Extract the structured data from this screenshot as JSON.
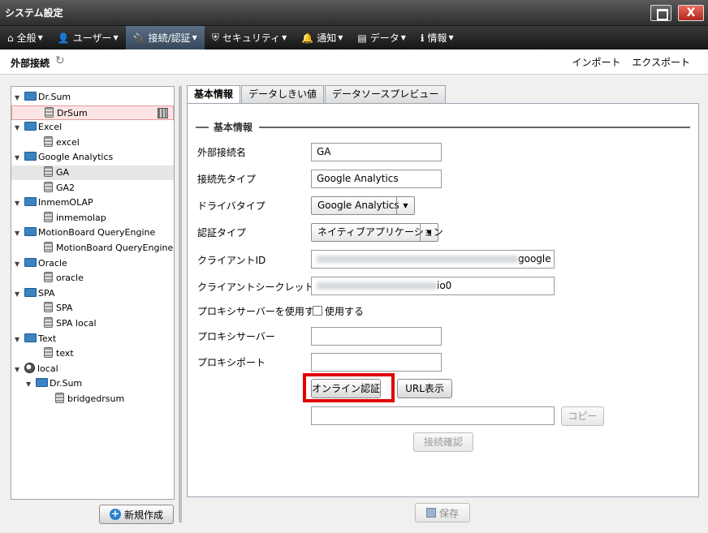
{
  "window": {
    "title": "システム設定",
    "close_label": "X"
  },
  "menu": [
    {
      "label": "全般",
      "icon": "home-icon",
      "glyph": "⌂"
    },
    {
      "label": "ユーザー",
      "icon": "user-icon",
      "glyph": "👤"
    },
    {
      "label": "接続/認証",
      "icon": "plug-icon",
      "glyph": "🔌",
      "active": true
    },
    {
      "label": "セキュリティ",
      "icon": "shield-icon",
      "glyph": "⛨"
    },
    {
      "label": "通知",
      "icon": "bell-icon",
      "glyph": "🔔"
    },
    {
      "label": "データ",
      "icon": "data-icon",
      "glyph": "▤"
    },
    {
      "label": "情報",
      "icon": "info-icon",
      "glyph": "ℹ"
    }
  ],
  "header": {
    "title": "外部接続",
    "import": "インポート",
    "export": "エクスポート"
  },
  "tree": [
    {
      "label": "Dr.Sum",
      "type": "folder",
      "depth": 0
    },
    {
      "label": "DrSum",
      "type": "db",
      "depth": 1,
      "selected": "red"
    },
    {
      "label": "Excel",
      "type": "folder",
      "depth": 0
    },
    {
      "label": "excel",
      "type": "db",
      "depth": 1
    },
    {
      "label": "Google Analytics",
      "type": "folder",
      "depth": 0
    },
    {
      "label": "GA",
      "type": "db",
      "depth": 1,
      "selected": "gray"
    },
    {
      "label": "GA2",
      "type": "db",
      "depth": 1
    },
    {
      "label": "InmemOLAP",
      "type": "folder",
      "depth": 0
    },
    {
      "label": "inmemolap",
      "type": "db",
      "depth": 1
    },
    {
      "label": "MotionBoard QueryEngine",
      "type": "folder",
      "depth": 0
    },
    {
      "label": "MotionBoard QueryEngine",
      "type": "db",
      "depth": 1
    },
    {
      "label": "Oracle",
      "type": "folder",
      "depth": 0
    },
    {
      "label": "oracle",
      "type": "db",
      "depth": 1
    },
    {
      "label": "SPA",
      "type": "folder",
      "depth": 0
    },
    {
      "label": "SPA",
      "type": "db",
      "depth": 1
    },
    {
      "label": "SPA local",
      "type": "db",
      "depth": 1
    },
    {
      "label": "Text",
      "type": "folder",
      "depth": 0
    },
    {
      "label": "text",
      "type": "db",
      "depth": 1
    },
    {
      "label": "local",
      "type": "globe",
      "depth": 0
    },
    {
      "label": "Dr.Sum",
      "type": "folder",
      "depth": 1
    },
    {
      "label": "bridgedrsum",
      "type": "db",
      "depth": 2
    }
  ],
  "new_button": "新規作成",
  "tabs": [
    "基本情報",
    "データしきい値",
    "データソースプレビュー"
  ],
  "form": {
    "section": "基本情報",
    "labels": {
      "name": "外部接続名",
      "type": "接続先タイプ",
      "driver": "ドライバタイプ",
      "auth": "認証タイプ",
      "client_id": "クライアントID",
      "client_secret": "クライアントシークレット",
      "use_proxy": "プロキシサーバーを使用する",
      "proxy_server": "プロキシサーバー",
      "proxy_port": "プロキシポート"
    },
    "values": {
      "name": "GA",
      "type": "Google Analytics",
      "driver": "Google Analytics",
      "auth": "ネイティブアプリケーション",
      "client_id_tail": "google",
      "client_secret_tail": "io0",
      "proxy_server": "",
      "proxy_port": "",
      "url": ""
    },
    "use_proxy_checkbox": "使用する"
  },
  "buttons": {
    "online_auth": "オンライン認証",
    "show_url": "URL表示",
    "copy": "コピー",
    "test_connection": "接続確認",
    "save": "保存"
  }
}
